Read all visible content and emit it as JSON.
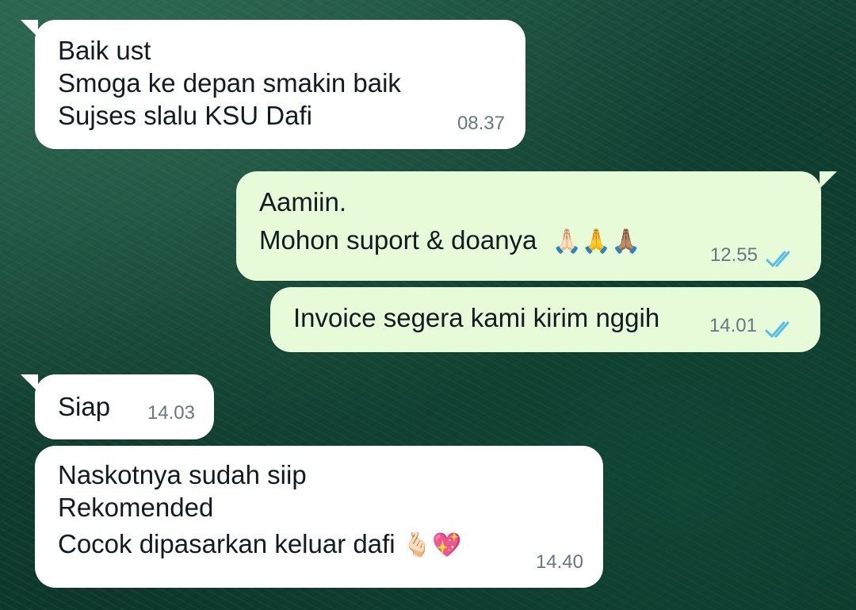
{
  "messages": [
    {
      "direction": "incoming",
      "lines": [
        "Baik ust",
        "Smoga ke depan smakin baik",
        "Sujses slalu KSU Dafi"
      ],
      "time": "08.37"
    },
    {
      "direction": "outgoing",
      "lines": [
        "Aamiin.",
        "Mohon suport & doanya"
      ],
      "emoji": "🙏🏻🙏🙏🏽",
      "time": "12.55",
      "status": "read",
      "status_icon": "double-check-icon",
      "status_color": "#53bdeb"
    },
    {
      "direction": "outgoing",
      "lines": [
        "Invoice segera kami kirim nggih"
      ],
      "time": "14.01",
      "status": "read",
      "status_icon": "double-check-icon",
      "status_color": "#53bdeb"
    },
    {
      "direction": "incoming",
      "lines": [
        "Siap"
      ],
      "time": "14.03"
    },
    {
      "direction": "incoming",
      "lines": [
        "Naskotnya sudah siip",
        "Rekomended",
        "Cocok dipasarkan keluar dafi"
      ],
      "emoji": "🫰🏻💖",
      "time": "14.40"
    }
  ],
  "colors": {
    "incoming_bubble": "#ffffff",
    "outgoing_bubble": "#e7fbd8",
    "timestamp": "#667781",
    "read_ticks": "#53bdeb"
  }
}
